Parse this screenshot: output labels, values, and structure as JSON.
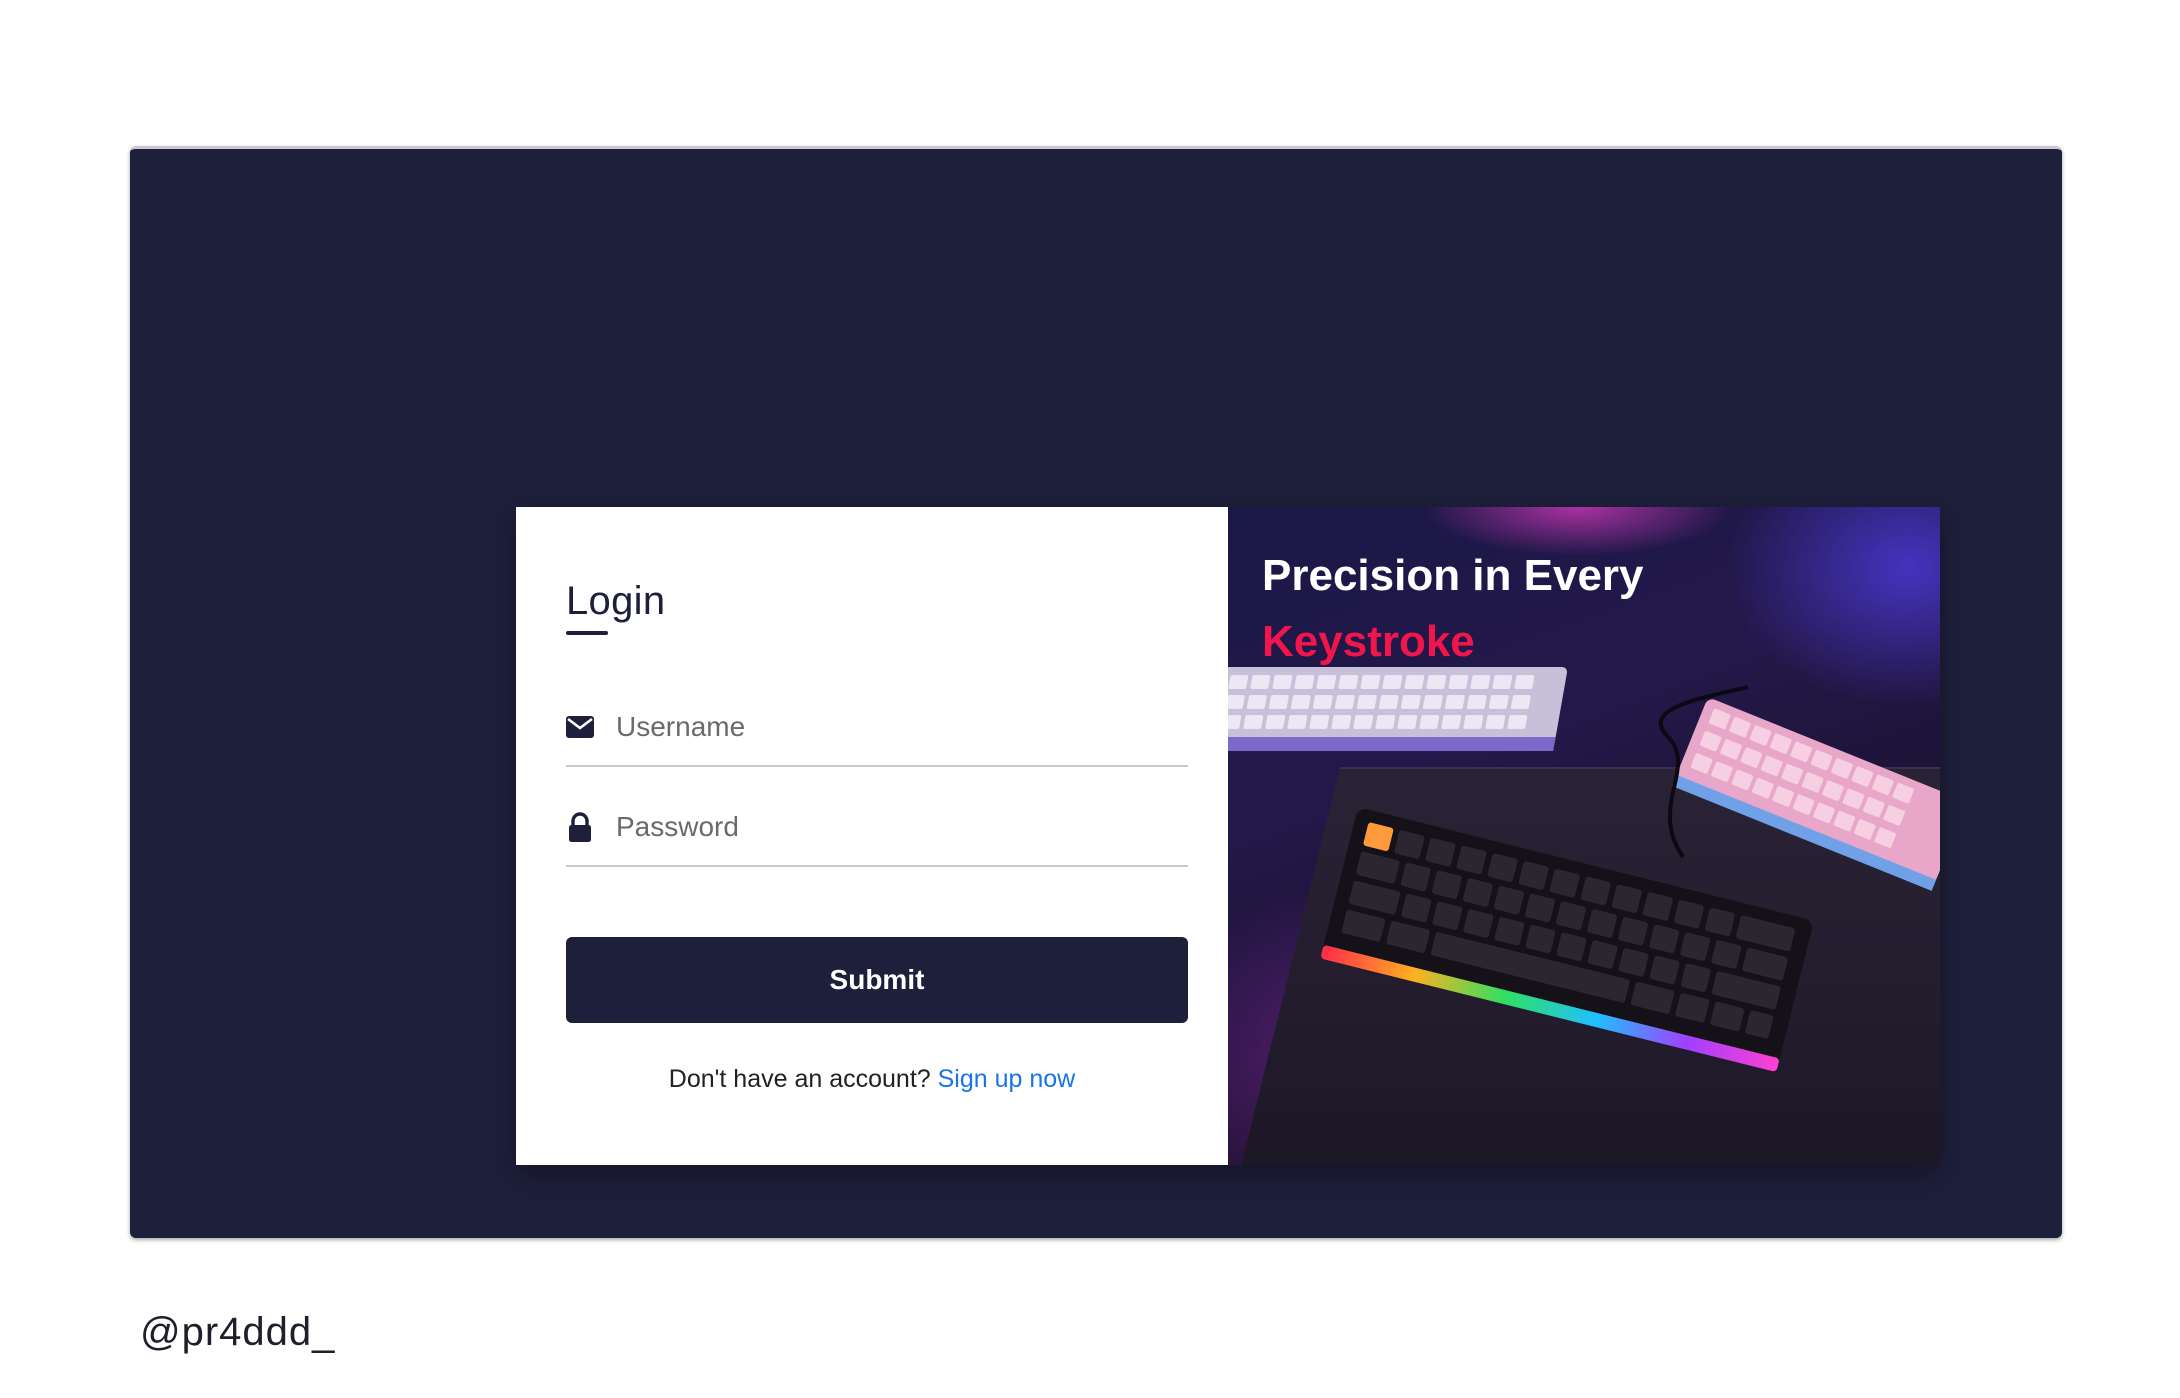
{
  "login": {
    "title": "Login",
    "username_placeholder": "Username",
    "password_placeholder": "Password",
    "submit_label": "Submit",
    "signup_prompt": "Don't have an account?",
    "signup_link": "Sign up now"
  },
  "hero": {
    "headline_line1": "Precision in Every",
    "headline_line2": "Keystroke"
  },
  "watermark": "@pr4ddd_",
  "colors": {
    "background": "#1e1f3b",
    "accent": "#f0164c",
    "link": "#1a73e8"
  },
  "icons": {
    "username": "envelope-icon",
    "password": "lock-icon"
  }
}
